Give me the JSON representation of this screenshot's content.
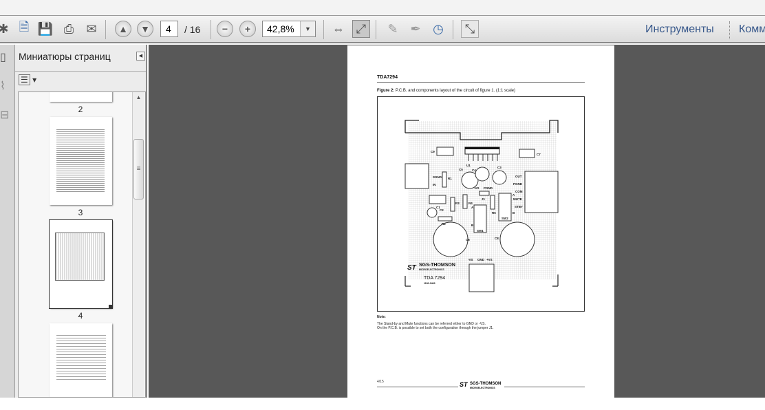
{
  "toolbar": {
    "current_page": "4",
    "total_pages": "/ 16",
    "zoom": "42,8%",
    "tools_link": "Инструменты",
    "comments_link": "Комм"
  },
  "sidebar": {
    "title": "Миниатюры страниц",
    "thumbnails": [
      {
        "label": "2"
      },
      {
        "label": "3"
      },
      {
        "label": "4"
      }
    ]
  },
  "document": {
    "header": "TDA7294",
    "figure_caption_bold": "Figure 2:",
    "figure_caption": " P.C.B. and components layout of the circuit of figure 1. (1:1 scale)",
    "pcb": {
      "labels": [
        "C9",
        "C7",
        "U1",
        "C5",
        "C4",
        "C3",
        "SGND",
        "R1",
        "IN",
        "OUT",
        "PGND",
        "COM",
        "MUTE",
        "STBY",
        "-VS",
        "PGND",
        "J1",
        "C1",
        "R3",
        "R4",
        "R5",
        "A",
        "B",
        "SW2",
        "C2",
        "R2",
        "SW1",
        "C6",
        "C8",
        "-VS",
        "GND",
        "+VS",
        "A",
        "B"
      ],
      "brand": "SGS-THOMSON",
      "brand_sub": "MICROELECTRONICS",
      "chip": "TDA 7294",
      "code": "1182-3463"
    },
    "note_title": "Note:",
    "note_lines": [
      "The Stand-by and Mute functions can be referred either to GND or -VS.",
      "On the P.C.B. is possible to set both the configuration through the jumper J1."
    ],
    "page_number": "4/15",
    "footer_brand": "SGS-THOMSON",
    "footer_sub": "MICROELECTRONICS"
  }
}
